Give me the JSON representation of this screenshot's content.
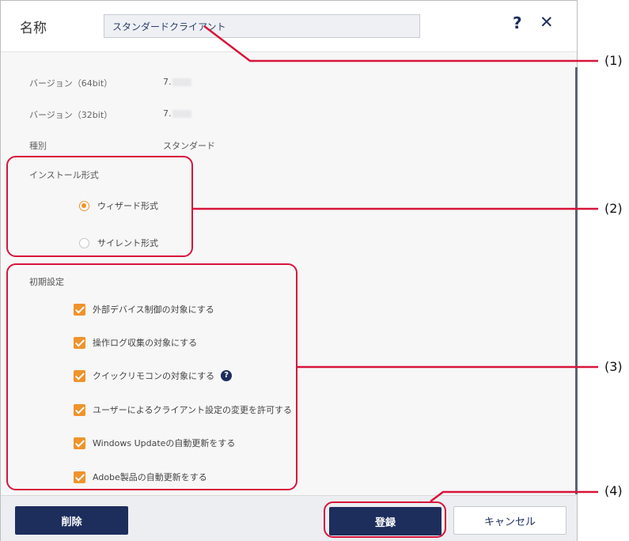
{
  "header": {
    "name_label": "名称",
    "name_value": "スタンダードクライアント",
    "help_glyph": "?",
    "close_glyph": "✕"
  },
  "info": {
    "version64_label": "バージョン（64bit）",
    "version64_value": "7.",
    "version32_label": "バージョン（32bit）",
    "version32_value": "7.",
    "type_label": "種別",
    "type_value": "スタンダード"
  },
  "install": {
    "title": "インストール形式",
    "options": [
      {
        "label": "ウィザード形式",
        "selected": true
      },
      {
        "label": "サイレント形式",
        "selected": false
      }
    ]
  },
  "initial": {
    "title": "初期設定",
    "items": [
      {
        "label": "外部デバイス制御の対象にする",
        "checked": true
      },
      {
        "label": "操作ログ収集の対象にする",
        "checked": true
      },
      {
        "label": "クイックリモコンの対象にする",
        "checked": true
      },
      {
        "label": "ユーザーによるクライアント設定の変更を許可する",
        "checked": true
      },
      {
        "label": "Windows Updateの自動更新をする",
        "checked": true
      },
      {
        "label": "Adobe製品の自動更新をする",
        "checked": true
      }
    ],
    "info_glyph": "?"
  },
  "footer": {
    "delete_label": "削除",
    "register_label": "登録",
    "cancel_label": "キャンセル"
  },
  "callouts": [
    "(1)",
    "(2)",
    "(3)",
    "(4)"
  ],
  "colors": {
    "accent": "#f0932b",
    "primary": "#1d2d5c",
    "highlight": "#d7153a"
  }
}
